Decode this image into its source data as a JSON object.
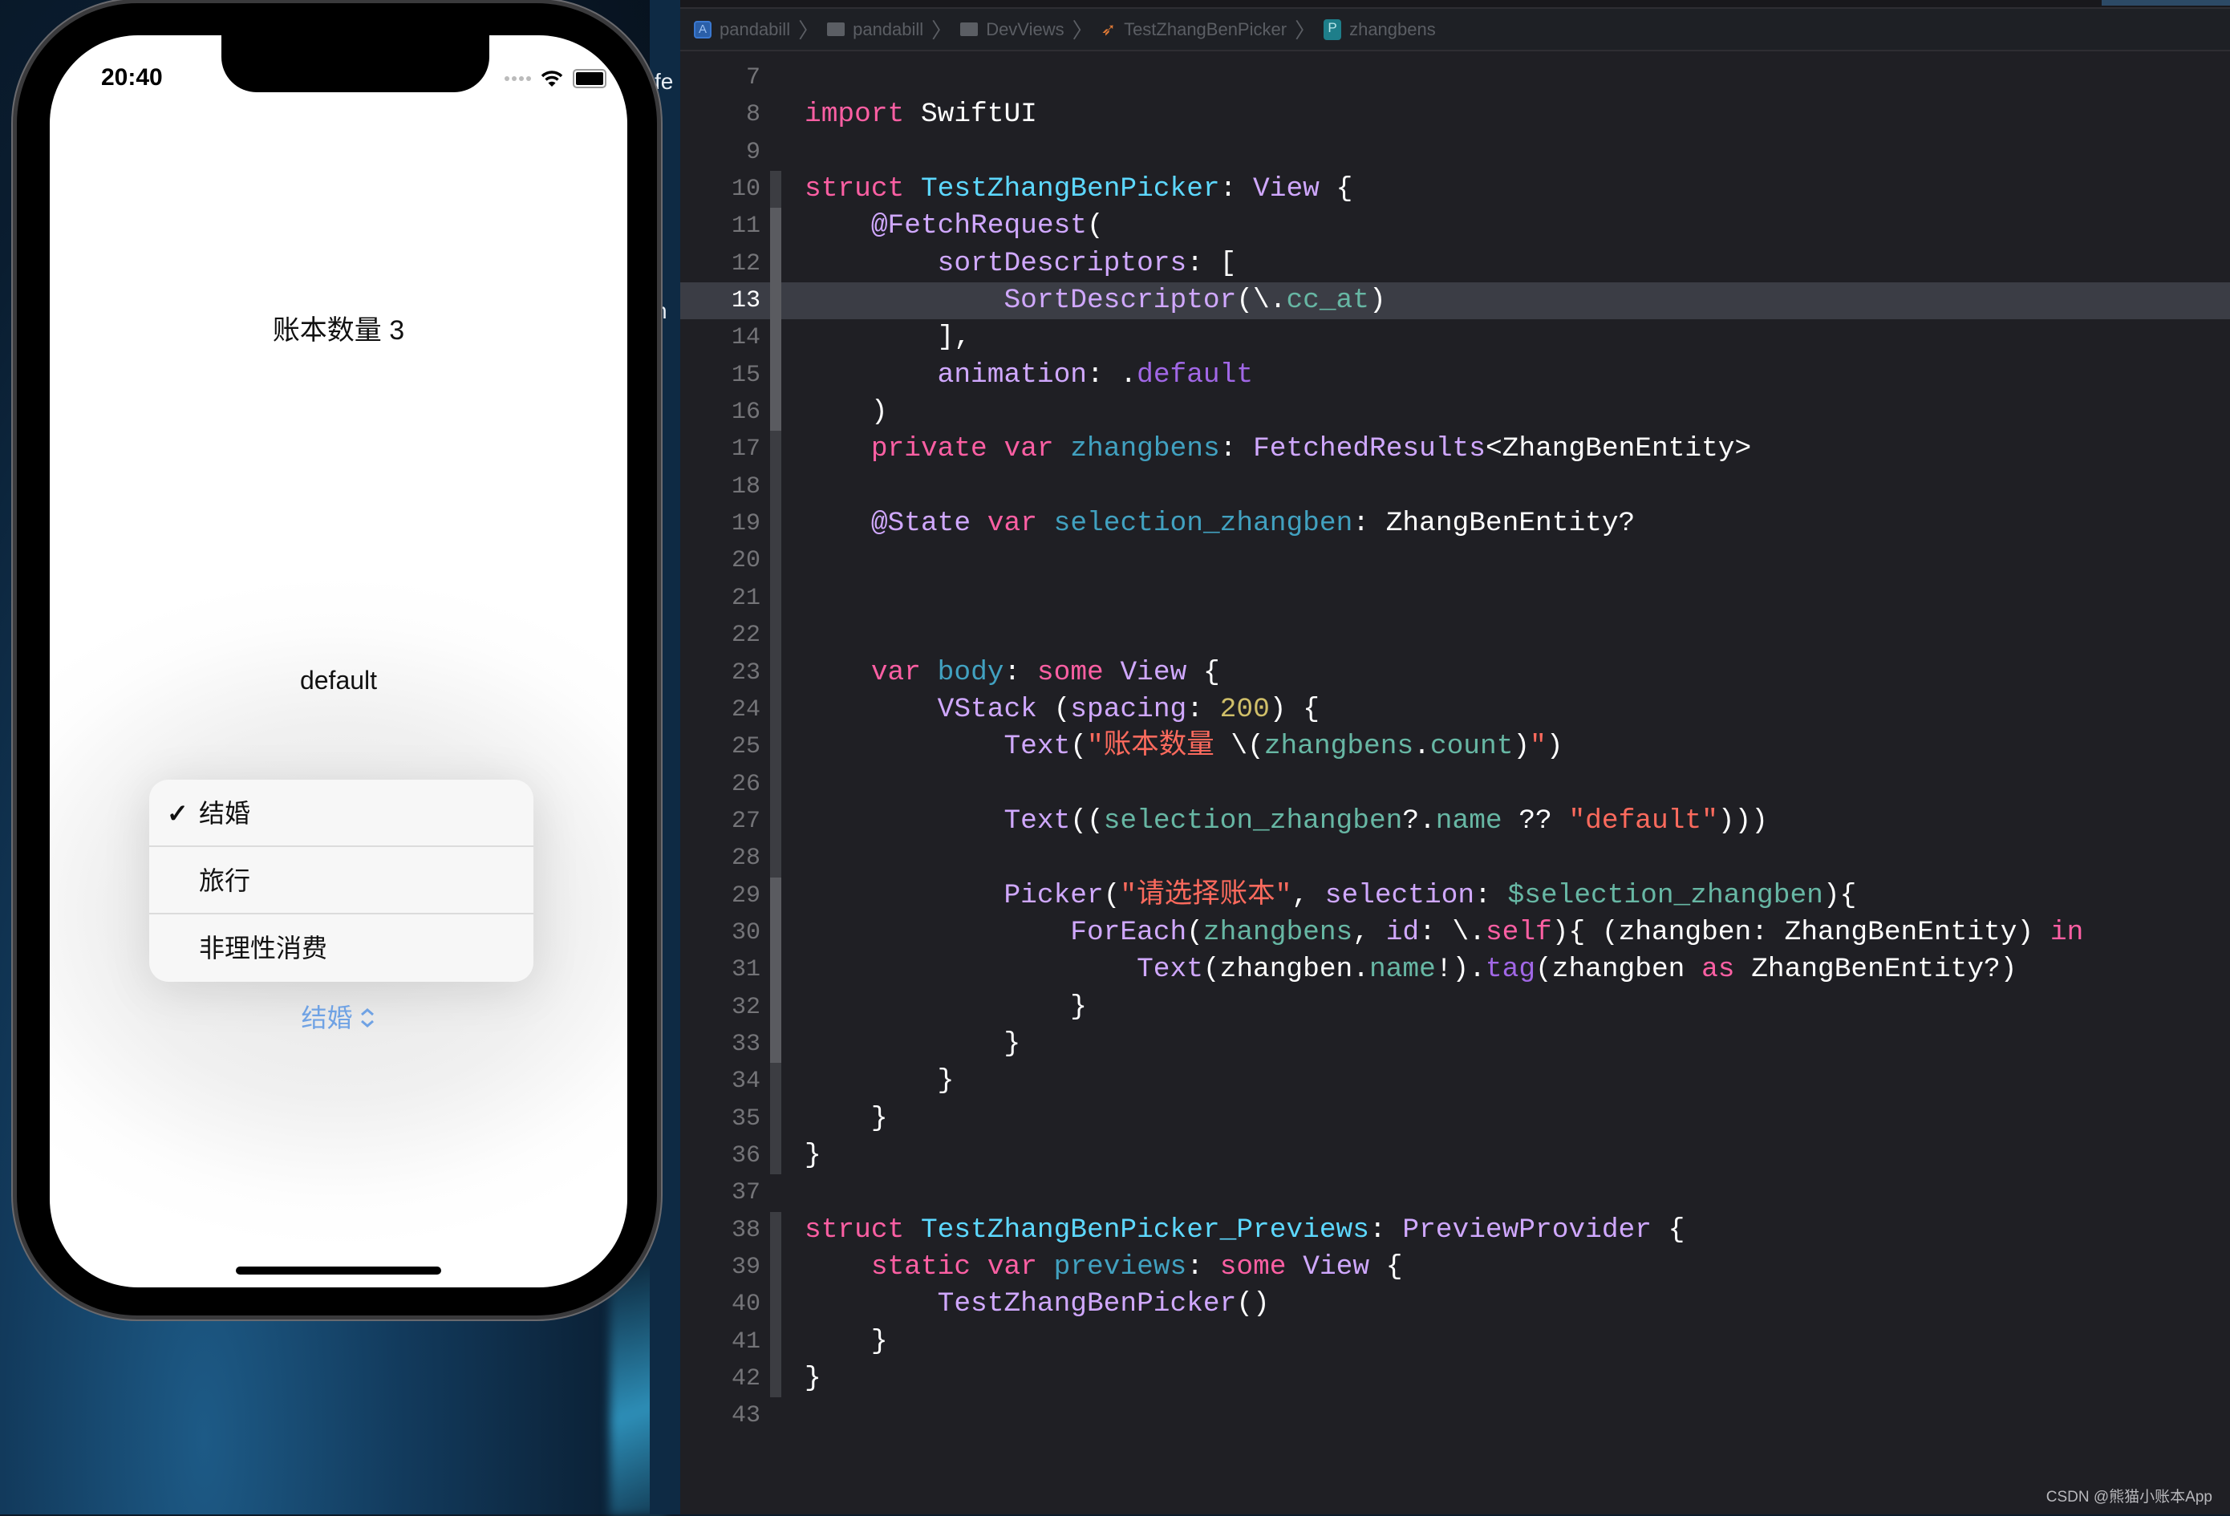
{
  "colors": {
    "kw": "#FC5FA3",
    "decl": "#5DD8FF",
    "declvar": "#41A1C0",
    "type": "#D0A8FF",
    "proj": "#67B7A4",
    "str": "#FC6A5D",
    "num": "#D0BF69",
    "member": "#A167E6",
    "plain": "#FFFFFF",
    "picker_accent": "#6FA2E4"
  },
  "simulator": {
    "status_time": "20:40",
    "count_text": "账本数量 3",
    "selection_text": "default",
    "menu_items": [
      {
        "label": "结婚",
        "checked": true
      },
      {
        "label": "旅行",
        "checked": false
      },
      {
        "label": "非理性消费",
        "checked": false
      }
    ],
    "check_glyph": "✓",
    "picker_value": "结婚",
    "picker_chevron": "⌃⌄"
  },
  "background_window": {
    "fragments": [
      "fe",
      "n"
    ]
  },
  "breadcrumb": [
    {
      "icon": "app-icon",
      "label": "pandabill"
    },
    {
      "icon": "folder-icon",
      "label": "pandabill"
    },
    {
      "icon": "folder-icon",
      "label": "DevViews"
    },
    {
      "icon": "swift-file-icon",
      "label": "TestZhangBenPicker"
    },
    {
      "icon": "property-icon",
      "label": "zhangbens"
    }
  ],
  "editor": {
    "current_line": 13,
    "lines": [
      {
        "n": "7",
        "t": []
      },
      {
        "n": "8",
        "t": [
          [
            "kw",
            "import"
          ],
          [
            "plain",
            " SwiftUI"
          ]
        ]
      },
      {
        "n": "9",
        "t": []
      },
      {
        "n": "10",
        "t": [
          [
            "kw",
            "struct"
          ],
          [
            "plain",
            " "
          ],
          [
            "decl",
            "TestZhangBenPicker"
          ],
          [
            "plain",
            ": "
          ],
          [
            "type",
            "View"
          ],
          [
            "plain",
            " {"
          ]
        ]
      },
      {
        "n": "11",
        "t": [
          [
            "plain",
            "    "
          ],
          [
            "type",
            "@FetchRequest"
          ],
          [
            "plain",
            "("
          ]
        ]
      },
      {
        "n": "12",
        "t": [
          [
            "plain",
            "        "
          ],
          [
            "type",
            "sortDescriptors"
          ],
          [
            "plain",
            ": ["
          ]
        ]
      },
      {
        "n": "13",
        "t": [
          [
            "plain",
            "            "
          ],
          [
            "type",
            "SortDescriptor"
          ],
          [
            "plain",
            "(\\."
          ],
          [
            "proj",
            "cc_at"
          ],
          [
            "plain",
            ")"
          ]
        ]
      },
      {
        "n": "14",
        "t": [
          [
            "plain",
            "        ],"
          ]
        ]
      },
      {
        "n": "15",
        "t": [
          [
            "plain",
            "        "
          ],
          [
            "type",
            "animation"
          ],
          [
            "plain",
            ": ."
          ],
          [
            "member",
            "default"
          ]
        ]
      },
      {
        "n": "16",
        "t": [
          [
            "plain",
            "    )"
          ]
        ]
      },
      {
        "n": "17",
        "t": [
          [
            "plain",
            "    "
          ],
          [
            "kw",
            "private"
          ],
          [
            "plain",
            " "
          ],
          [
            "kw",
            "var"
          ],
          [
            "plain",
            " "
          ],
          [
            "declvar",
            "zhangbens"
          ],
          [
            "plain",
            ": "
          ],
          [
            "type",
            "FetchedResults"
          ],
          [
            "plain",
            "<ZhangBenEntity>"
          ]
        ]
      },
      {
        "n": "18",
        "t": []
      },
      {
        "n": "19",
        "t": [
          [
            "plain",
            "    "
          ],
          [
            "type",
            "@State"
          ],
          [
            "plain",
            " "
          ],
          [
            "kw",
            "var"
          ],
          [
            "plain",
            " "
          ],
          [
            "declvar",
            "selection_zhangben"
          ],
          [
            "plain",
            ": ZhangBenEntity?"
          ]
        ]
      },
      {
        "n": "20",
        "t": []
      },
      {
        "n": "21",
        "t": []
      },
      {
        "n": "22",
        "t": []
      },
      {
        "n": "23",
        "t": [
          [
            "plain",
            "    "
          ],
          [
            "kw",
            "var"
          ],
          [
            "plain",
            " "
          ],
          [
            "declvar",
            "body"
          ],
          [
            "plain",
            ": "
          ],
          [
            "kw",
            "some"
          ],
          [
            "plain",
            " "
          ],
          [
            "type",
            "View"
          ],
          [
            "plain",
            " {"
          ]
        ]
      },
      {
        "n": "24",
        "t": [
          [
            "plain",
            "        "
          ],
          [
            "type",
            "VStack"
          ],
          [
            "plain",
            " ("
          ],
          [
            "type",
            "spacing"
          ],
          [
            "plain",
            ": "
          ],
          [
            "num",
            "200"
          ],
          [
            "plain",
            ") {"
          ]
        ]
      },
      {
        "n": "25",
        "t": [
          [
            "plain",
            "            "
          ],
          [
            "type",
            "Text"
          ],
          [
            "plain",
            "("
          ],
          [
            "str",
            "\"账本数量 "
          ],
          [
            "plain",
            "\\("
          ],
          [
            "proj",
            "zhangbens"
          ],
          [
            "plain",
            "."
          ],
          [
            "proj",
            "count"
          ],
          [
            "plain",
            ")"
          ],
          [
            "str",
            "\""
          ],
          [
            "plain",
            ")"
          ]
        ]
      },
      {
        "n": "26",
        "t": []
      },
      {
        "n": "27",
        "t": [
          [
            "plain",
            "            "
          ],
          [
            "type",
            "Text"
          ],
          [
            "plain",
            "(("
          ],
          [
            "proj",
            "selection_zhangben"
          ],
          [
            "plain",
            "?."
          ],
          [
            "proj",
            "name"
          ],
          [
            "plain",
            " ?? "
          ],
          [
            "str",
            "\"default\""
          ],
          [
            "plain",
            ")))"
          ]
        ]
      },
      {
        "n": "28",
        "t": []
      },
      {
        "n": "29",
        "t": [
          [
            "plain",
            "            "
          ],
          [
            "type",
            "Picker"
          ],
          [
            "plain",
            "("
          ],
          [
            "str",
            "\"请选择账本\""
          ],
          [
            "plain",
            ", "
          ],
          [
            "type",
            "selection"
          ],
          [
            "plain",
            ": "
          ],
          [
            "proj",
            "$selection_zhangben"
          ],
          [
            "plain",
            "){"
          ]
        ]
      },
      {
        "n": "30",
        "t": [
          [
            "plain",
            "                "
          ],
          [
            "type",
            "ForEach"
          ],
          [
            "plain",
            "("
          ],
          [
            "proj",
            "zhangbens"
          ],
          [
            "plain",
            ", "
          ],
          [
            "type",
            "id"
          ],
          [
            "plain",
            ": \\."
          ],
          [
            "kw",
            "self"
          ],
          [
            "plain",
            "){ (zhangben: ZhangBenEntity) "
          ],
          [
            "kw",
            "in"
          ]
        ]
      },
      {
        "n": "31",
        "t": [
          [
            "plain",
            "                    "
          ],
          [
            "type",
            "Text"
          ],
          [
            "plain",
            "(zhangben."
          ],
          [
            "proj",
            "name"
          ],
          [
            "plain",
            "!)."
          ],
          [
            "member",
            "tag"
          ],
          [
            "plain",
            "(zhangben "
          ],
          [
            "kw",
            "as"
          ],
          [
            "plain",
            " ZhangBenEntity?)"
          ]
        ]
      },
      {
        "n": "32",
        "t": [
          [
            "plain",
            "                }"
          ]
        ]
      },
      {
        "n": "33",
        "t": [
          [
            "plain",
            "            }"
          ]
        ]
      },
      {
        "n": "34",
        "t": [
          [
            "plain",
            "        }"
          ]
        ]
      },
      {
        "n": "35",
        "t": [
          [
            "plain",
            "    }"
          ]
        ]
      },
      {
        "n": "36",
        "t": [
          [
            "plain",
            "}"
          ]
        ]
      },
      {
        "n": "37",
        "t": []
      },
      {
        "n": "38",
        "t": [
          [
            "kw",
            "struct"
          ],
          [
            "plain",
            " "
          ],
          [
            "decl",
            "TestZhangBenPicker_Previews"
          ],
          [
            "plain",
            ": "
          ],
          [
            "type",
            "PreviewProvider"
          ],
          [
            "plain",
            " {"
          ]
        ]
      },
      {
        "n": "39",
        "t": [
          [
            "plain",
            "    "
          ],
          [
            "kw",
            "static"
          ],
          [
            "plain",
            " "
          ],
          [
            "kw",
            "var"
          ],
          [
            "plain",
            " "
          ],
          [
            "declvar",
            "previews"
          ],
          [
            "plain",
            ": "
          ],
          [
            "kw",
            "some"
          ],
          [
            "plain",
            " "
          ],
          [
            "type",
            "View"
          ],
          [
            "plain",
            " {"
          ]
        ]
      },
      {
        "n": "40",
        "t": [
          [
            "plain",
            "        "
          ],
          [
            "type",
            "TestZhangBenPicker"
          ],
          [
            "plain",
            "()"
          ]
        ]
      },
      {
        "n": "41",
        "t": [
          [
            "plain",
            "    }"
          ]
        ]
      },
      {
        "n": "42",
        "t": [
          [
            "plain",
            "}"
          ]
        ]
      },
      {
        "n": "43",
        "t": []
      }
    ]
  },
  "watermark": "CSDN @熊猫小账本App"
}
